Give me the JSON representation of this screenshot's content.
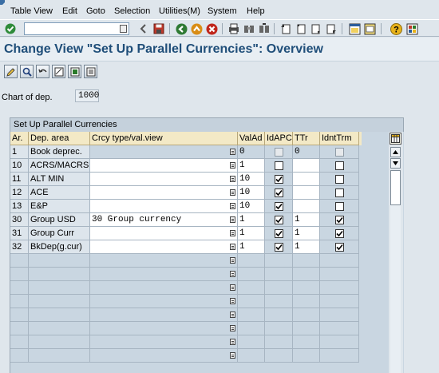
{
  "menu": {
    "items": [
      "Table View",
      "Edit",
      "Goto",
      "Selection",
      "Utilities(M)",
      "System",
      "Help"
    ]
  },
  "toolbar": {
    "command_field_value": "",
    "icons": [
      "enter-icon",
      "back-arrow-icon",
      "save-icon",
      "back-icon",
      "exit-icon",
      "cancel-icon",
      "print-icon",
      "find-icon",
      "find-next-icon",
      "first-page-icon",
      "previous-page-icon",
      "next-page-icon",
      "last-page-icon",
      "create-session-icon",
      "shortcut-icon",
      "help-icon",
      "customize-layout-icon"
    ]
  },
  "title": "Change View \"Set Up Parallel Currencies\": Overview",
  "app_toolbar": {
    "icons": [
      "change-display-icon",
      "select-all-icon",
      "undo-change-icon",
      "select-block-icon",
      "deselect-all-icon",
      "details-icon"
    ]
  },
  "chart_of_dep": {
    "label": "Chart of dep.",
    "value": "1000"
  },
  "table": {
    "title": "Set Up Parallel Currencies",
    "columns": [
      "Ar.",
      "Dep. area",
      "Crcy type/val.view",
      "ValAd",
      "IdAPC",
      "TTr",
      "IdntTrm"
    ],
    "rows": [
      {
        "ar": "1",
        "area": "Book deprec.",
        "crcy": "",
        "valad": "0",
        "idapc": false,
        "idapc_disabled": true,
        "ttr": "0",
        "idnt": false,
        "idnt_disabled": true
      },
      {
        "ar": "10",
        "area": "ACRS/MACRS",
        "crcy": "",
        "valad": "1",
        "idapc": false,
        "idapc_disabled": false,
        "ttr": "",
        "idnt": false,
        "idnt_disabled": false
      },
      {
        "ar": "11",
        "area": "ALT MIN",
        "crcy": "",
        "valad": "10",
        "idapc": true,
        "idapc_disabled": false,
        "ttr": "",
        "idnt": false,
        "idnt_disabled": false
      },
      {
        "ar": "12",
        "area": "ACE",
        "crcy": "",
        "valad": "10",
        "idapc": true,
        "idapc_disabled": false,
        "ttr": "",
        "idnt": false,
        "idnt_disabled": false
      },
      {
        "ar": "13",
        "area": "E&P",
        "crcy": "",
        "valad": "10",
        "idapc": true,
        "idapc_disabled": false,
        "ttr": "",
        "idnt": false,
        "idnt_disabled": false
      },
      {
        "ar": "30",
        "area": "Group USD",
        "crcy": "30 Group currency",
        "valad": "1",
        "idapc": true,
        "idapc_disabled": false,
        "ttr": "1",
        "idnt": true,
        "idnt_disabled": false
      },
      {
        "ar": "31",
        "area": "Group Curr",
        "crcy": "",
        "valad": "1",
        "idapc": true,
        "idapc_disabled": false,
        "ttr": "1",
        "idnt": true,
        "idnt_disabled": false
      },
      {
        "ar": "32",
        "area": "BkDep(g.cur)",
        "crcy": "",
        "valad": "1",
        "idapc": true,
        "idapc_disabled": false,
        "ttr": "1",
        "idnt": true,
        "idnt_disabled": false
      }
    ],
    "empty_rows": 8
  },
  "colors": {
    "title_text": "#1f4e79",
    "header_bg": "#f3e9c6",
    "key_cell_bg": "#dde5ec",
    "screen_bg": "#dfe6ec"
  }
}
